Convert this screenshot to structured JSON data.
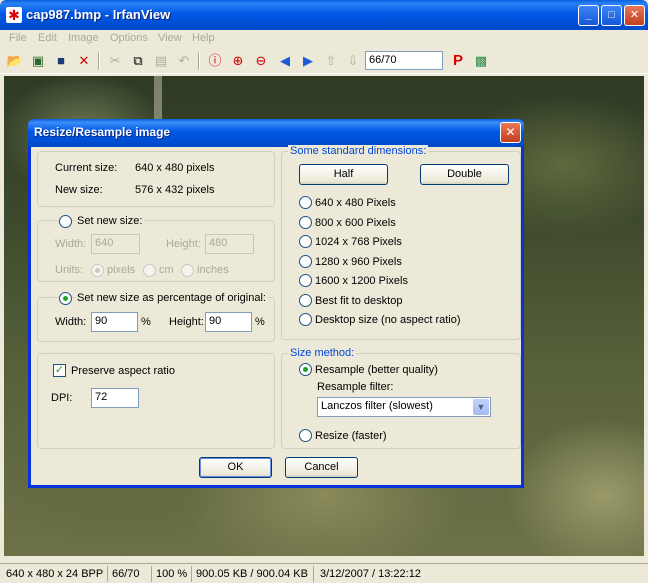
{
  "window": {
    "title": "cap987.bmp - IrfanView"
  },
  "menu": [
    "File",
    "Edit",
    "Image",
    "Options",
    "View",
    "Help"
  ],
  "toolbar": {
    "page_value": "66/70"
  },
  "status": {
    "dims": "640 x 480 x 24 BPP",
    "page": "66/70",
    "zoom": "100 %",
    "size": "900.05 KB / 900.04 KB",
    "datetime": "3/12/2007 / 13:22:12"
  },
  "dialog": {
    "title": "Resize/Resample image",
    "current_size_label": "Current size:",
    "current_size_value": "640  x  480  pixels",
    "new_size_label": "New size:",
    "new_size_value": "576  x  432  pixels",
    "set_new_size": {
      "label": "Set new size:",
      "width_label": "Width:",
      "width_value": "640",
      "height_label": "Height:",
      "height_value": "480",
      "units_label": "Units:",
      "units": [
        "pixels",
        "cm",
        "inches"
      ]
    },
    "percent": {
      "label": "Set new size as percentage of original:",
      "width_label": "Width:",
      "width_value": "90",
      "height_label": "Height:",
      "height_value": "90",
      "unit": "%"
    },
    "preserve_aspect": "Preserve aspect ratio",
    "dpi_label": "DPI:",
    "dpi_value": "72",
    "standard": {
      "legend": "Some standard dimensions:",
      "half": "Half",
      "double": "Double",
      "options": [
        "640 x 480 Pixels",
        "800 x 600 Pixels",
        "1024 x 768 Pixels",
        "1280 x 960 Pixels",
        "1600 x 1200 Pixels",
        "Best fit to desktop",
        "Desktop size (no aspect ratio)"
      ]
    },
    "method": {
      "legend": "Size method:",
      "resample": "Resample (better quality)",
      "filter_label": "Resample filter:",
      "filter_value": "Lanczos filter (slowest)",
      "resize": "Resize (faster)"
    },
    "ok": "OK",
    "cancel": "Cancel"
  },
  "colors": {
    "titlebar": "#0058e6",
    "group_legend": "#0046d5",
    "radio_dot": "#21a121"
  }
}
